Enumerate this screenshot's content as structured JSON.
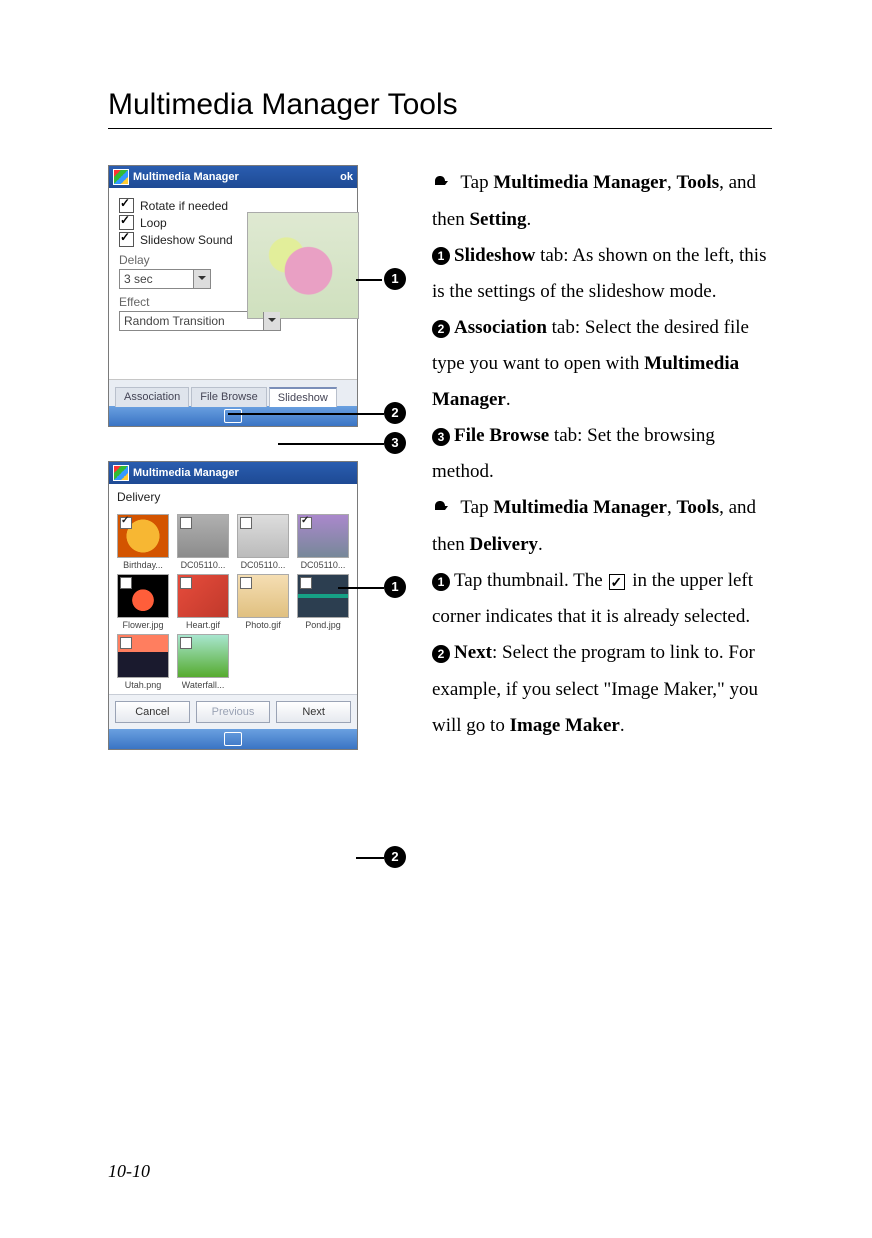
{
  "page": {
    "title": "Multimedia Manager Tools",
    "number": "10-10"
  },
  "screenA": {
    "titlebar": "Multimedia Manager",
    "ok": "ok",
    "checks": [
      "Rotate if needed",
      "Loop",
      "Slideshow Sound"
    ],
    "delay_label": "Delay",
    "delay_value": "3 sec",
    "effect_label": "Effect",
    "effect_value": "Random Transition",
    "tabs": [
      "Association",
      "File Browse",
      "Slideshow"
    ]
  },
  "screenB": {
    "titlebar": "Multimedia Manager",
    "header": "Delivery",
    "thumbs": [
      {
        "cap": "Birthday...",
        "sel": true,
        "c": "c0"
      },
      {
        "cap": "DC05110...",
        "sel": false,
        "c": "c1"
      },
      {
        "cap": "DC05110...",
        "sel": false,
        "c": "c2"
      },
      {
        "cap": "DC05110...",
        "sel": true,
        "c": "c3"
      },
      {
        "cap": "Flower.jpg",
        "sel": false,
        "c": "c4"
      },
      {
        "cap": "Heart.gif",
        "sel": false,
        "c": "c5"
      },
      {
        "cap": "Photo.gif",
        "sel": false,
        "c": "c6"
      },
      {
        "cap": "Pond.jpg",
        "sel": false,
        "c": "c7"
      },
      {
        "cap": "Utah.png",
        "sel": false,
        "c": "c8"
      },
      {
        "cap": "Waterfall...",
        "sel": false,
        "c": "c9"
      }
    ],
    "buttons": {
      "cancel": "Cancel",
      "prev": "Previous",
      "next": "Next"
    }
  },
  "text": {
    "intro1a": " Tap ",
    "intro1b": "Multimedia Manager",
    "intro1c": ", ",
    "intro1d": "Tools",
    "intro1e": ", and then ",
    "intro1f": "Setting",
    "intro1g": ".",
    "b1a": "Slideshow",
    "b1b": " tab: As shown on the left, this is the settings of the slideshow mode.",
    "b2a": "Association",
    "b2b": " tab: Select the desired file type you want to open with ",
    "b2c": "Multimedia Manager",
    "b2d": ".",
    "b3a": "File Browse",
    "b3b": " tab: Set the browsing method.",
    "intro2a": " Tap ",
    "intro2b": "Multimedia Manager",
    "intro2c": ", ",
    "intro2d": "Tools",
    "intro2e": ", and then ",
    "intro2f": "Delivery",
    "intro2g": ".",
    "c1a": "Tap thumbnail. The ",
    "c1b": " in the upper left corner indicates that it is already selected.",
    "c2a": "Next",
    "c2b": ": Select the program to link to. For example, if you select \"Image Maker,\" you will go to ",
    "c2c": "Image Maker",
    "c2d": "."
  },
  "callouts": {
    "n1": "1",
    "n2": "2",
    "n3": "3"
  }
}
